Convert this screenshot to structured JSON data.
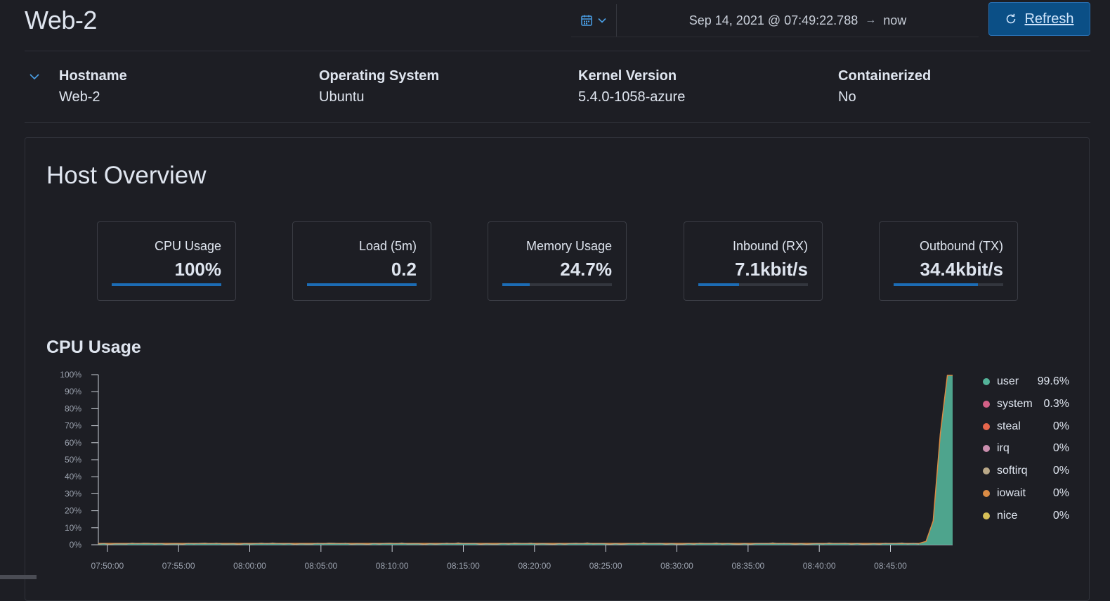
{
  "header": {
    "title": "Web-2",
    "date_start": "Sep 14, 2021 @ 07:49:22.788",
    "arrow": "→",
    "date_end": "now",
    "refresh_label": "Refresh"
  },
  "host_info": [
    {
      "label": "Hostname",
      "value": "Web-2"
    },
    {
      "label": "Operating System",
      "value": "Ubuntu"
    },
    {
      "label": "Kernel Version",
      "value": "5.4.0-1058-azure"
    },
    {
      "label": "Containerized",
      "value": "No"
    }
  ],
  "overview": {
    "title": "Host Overview",
    "stats": [
      {
        "label": "CPU Usage",
        "value": "100%",
        "fill": 1.0
      },
      {
        "label": "Load (5m)",
        "value": "0.2",
        "fill": 1.0
      },
      {
        "label": "Memory Usage",
        "value": "24.7%",
        "fill": 0.247
      },
      {
        "label": "Inbound (RX)",
        "value": "7.1kbit/s",
        "fill": 0.37
      },
      {
        "label": "Outbound (TX)",
        "value": "34.4kbit/s",
        "fill": 0.77
      }
    ]
  },
  "cpu_chart_title": "CPU Usage",
  "colors": {
    "user": "#54b399",
    "system": "#d36086",
    "steal": "#e7664c",
    "irq": "#ca8eae",
    "softirq": "#b9a888",
    "iowait": "#da8b45",
    "nice": "#d6bf57",
    "accent": "#0b4f86"
  },
  "chart_data": {
    "type": "area",
    "title": "CPU Usage",
    "x_ticks": [
      "07:50:00",
      "07:55:00",
      "08:00:00",
      "08:05:00",
      "08:10:00",
      "08:15:00",
      "08:20:00",
      "08:25:00",
      "08:30:00",
      "08:35:00",
      "08:40:00",
      "08:45:00"
    ],
    "y_ticks": [
      "0%",
      "10%",
      "20%",
      "30%",
      "40%",
      "50%",
      "60%",
      "70%",
      "80%",
      "90%",
      "100%"
    ],
    "ylim": [
      0,
      100
    ],
    "x_range": [
      "07:49:22",
      "08:49:22"
    ],
    "series": [
      {
        "name": "user",
        "legend_value": "99.6%",
        "color": "#54b399",
        "x": [
          "07:49:22",
          "08:47:00",
          "08:47:30",
          "08:48:00",
          "08:48:30",
          "08:49:00",
          "08:49:22"
        ],
        "values": [
          0.8,
          0.8,
          2,
          14,
          65,
          99.6,
          99.6
        ]
      },
      {
        "name": "system",
        "legend_value": "0.3%",
        "color": "#d36086"
      },
      {
        "name": "steal",
        "legend_value": "0%",
        "color": "#e7664c"
      },
      {
        "name": "irq",
        "legend_value": "0%",
        "color": "#ca8eae"
      },
      {
        "name": "softirq",
        "legend_value": "0%",
        "color": "#b9a888"
      },
      {
        "name": "iowait",
        "legend_value": "0%",
        "color": "#da8b45"
      },
      {
        "name": "nice",
        "legend_value": "0%",
        "color": "#d6bf57"
      }
    ],
    "legend_position": "right"
  }
}
